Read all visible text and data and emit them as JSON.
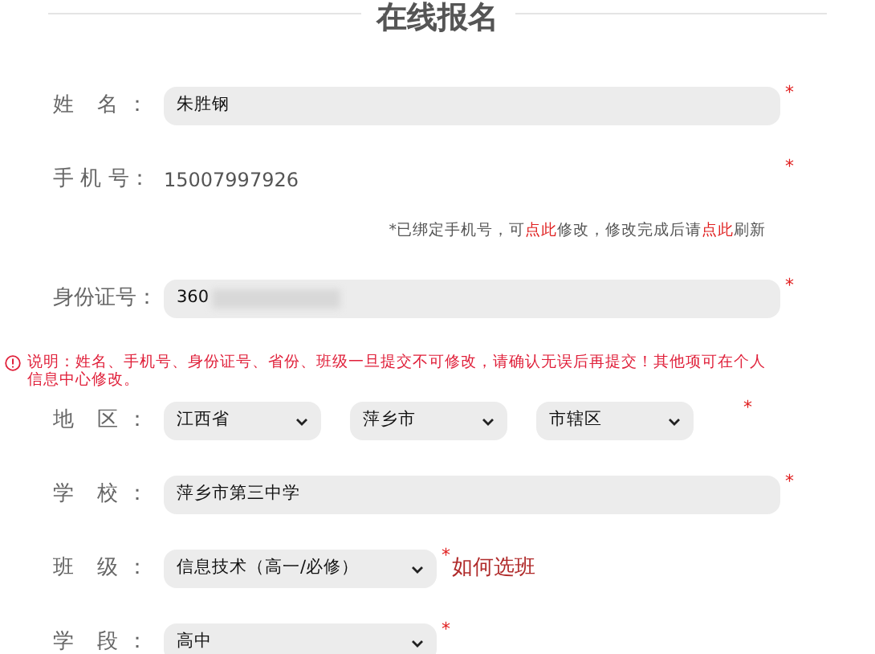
{
  "title": "在线报名",
  "required_mark": "*",
  "rows": [
    {
      "kind": "input",
      "label": "姓 名：",
      "value": "朱胜钢",
      "required": true
    },
    {
      "kind": "static",
      "label": "手 机 号：",
      "value": "15007997926",
      "required": true
    },
    {
      "kind": "note",
      "parts": [
        {
          "text": "*已绑定手机号，可",
          "link": false
        },
        {
          "text": "点此",
          "link": true
        },
        {
          "text": "修改，修改完成后请",
          "link": false
        },
        {
          "text": "点此",
          "link": true
        },
        {
          "text": "刷新",
          "link": false
        }
      ]
    },
    {
      "kind": "input",
      "label": "身份证号：",
      "value": "360",
      "redacted": true,
      "required": true
    },
    {
      "kind": "warning",
      "text": "说明：姓名、手机号、身份证号、省份、班级一旦提交不可修改，请确认无误后再提交！其他项可在个人信息中心修改。"
    },
    {
      "kind": "selects",
      "label": "地 区：",
      "values": [
        "江西省",
        "萍乡市",
        "市辖区"
      ],
      "required": true
    },
    {
      "kind": "input",
      "label": "学 校：",
      "value": "萍乡市第三中学",
      "required": true
    },
    {
      "kind": "select",
      "label": "班 级：",
      "value": "信息技术（高一/必修）",
      "required": true,
      "link": "如何选班"
    },
    {
      "kind": "select",
      "label": "学 段：",
      "value": "高中",
      "required": true
    }
  ]
}
